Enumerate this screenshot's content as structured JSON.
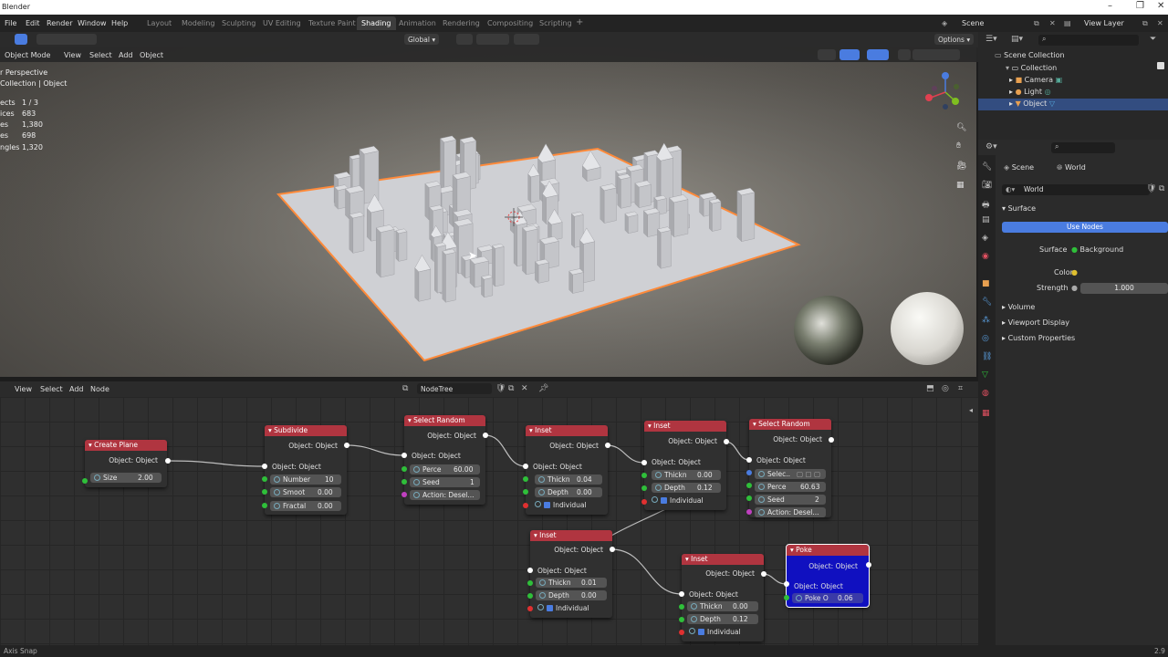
{
  "app": {
    "title": "Blender"
  },
  "menu": {
    "items": [
      "File",
      "Edit",
      "Render",
      "Window",
      "Help"
    ]
  },
  "workspaces": {
    "tabs": [
      "Layout",
      "Modeling",
      "Sculpting",
      "UV Editing",
      "Texture Paint",
      "Shading",
      "Animation",
      "Rendering",
      "Compositing",
      "Scripting"
    ],
    "active": "Shading",
    "add": "+"
  },
  "topright": {
    "scene": "Scene",
    "view_layer": "View Layer"
  },
  "viewport": {
    "mode": "Object Mode",
    "menus": [
      "View",
      "Select",
      "Add",
      "Object"
    ],
    "orientation": "Global",
    "options": "Options",
    "info_title": "r Perspective",
    "info_collection": "Collection | Object",
    "stats": [
      [
        "ects",
        "1 / 3"
      ],
      [
        "ices",
        "683"
      ],
      [
        "es",
        "1,380"
      ],
      [
        "es",
        "698"
      ],
      [
        "ngles",
        "1,320"
      ]
    ]
  },
  "node_editor": {
    "menus": [
      "View",
      "Select",
      "Add",
      "Node"
    ],
    "tree_name": "NodeTree"
  },
  "nodes": {
    "create_plane": {
      "title": "Create Plane",
      "out": "Object: Object",
      "size_label": "Size",
      "size": "2.00"
    },
    "subdivide": {
      "title": "Subdivide",
      "out": "Object: Object",
      "in": "Object: Object",
      "number_label": "Number",
      "number": "10",
      "smooth_label": "Smoot",
      "smooth": "0.00",
      "fractal_label": "Fractal",
      "fractal": "0.00"
    },
    "select_random1": {
      "title": "Select Random",
      "out": "Object: Object",
      "in": "Object: Object",
      "percent_label": "Perce",
      "percent": "60.00",
      "seed_label": "Seed",
      "seed": "1",
      "action": "Action: Desel..."
    },
    "inset1": {
      "title": "Inset",
      "out": "Object: Object",
      "in": "Object: Object",
      "thick_label": "Thickn",
      "thick": "0.04",
      "depth_label": "Depth",
      "depth": "0.00",
      "individual": "Individual"
    },
    "inset2": {
      "title": "Inset",
      "out": "Object: Object",
      "in": "Object: Object",
      "thick_label": "Thickn",
      "thick": "0.00",
      "depth_label": "Depth",
      "depth": "0.12",
      "individual": "Individual"
    },
    "select_random2": {
      "title": "Select Random",
      "out": "Object: Object",
      "in": "Object: Object",
      "select_label": "Selec..",
      "percent_label": "Perce",
      "percent": "60.63",
      "seed_label": "Seed",
      "seed": "2",
      "action": "Action: Desel..."
    },
    "inset3": {
      "title": "Inset",
      "out": "Object: Object",
      "in": "Object: Object",
      "thick_label": "Thickn",
      "thick": "0.01",
      "depth_label": "Depth",
      "depth": "0.00",
      "individual": "Individual"
    },
    "inset4": {
      "title": "Inset",
      "out": "Object: Object",
      "in": "Object: Object",
      "thick_label": "Thickn",
      "thick": "0.00",
      "depth_label": "Depth",
      "depth": "0.12",
      "individual": "Individual"
    },
    "poke": {
      "title": "Poke",
      "out": "Object: Object",
      "in": "Object: Object",
      "offset_label": "Poke O",
      "offset": "0.06"
    }
  },
  "outliner": {
    "root": "Scene Collection",
    "collection": "Collection",
    "items": [
      "Camera",
      "Light",
      "Object"
    ]
  },
  "properties": {
    "crumb_scene": "Scene",
    "crumb_world": "World",
    "world_name": "World",
    "section": "Surface",
    "use_nodes": "Use Nodes",
    "surface_label": "Surface",
    "surface_value": "Background",
    "color_label": "Color",
    "strength_label": "Strength",
    "strength": "1.000",
    "panels": [
      "Volume",
      "Viewport Display",
      "Custom Properties"
    ]
  },
  "status": {
    "left": "Axis Snap",
    "right": "2.9"
  },
  "colors": {
    "node_header": "#b03540",
    "selected_node": "#1010c0",
    "accent": "#4a7ce0",
    "object_outline": "#ff8a3a"
  }
}
